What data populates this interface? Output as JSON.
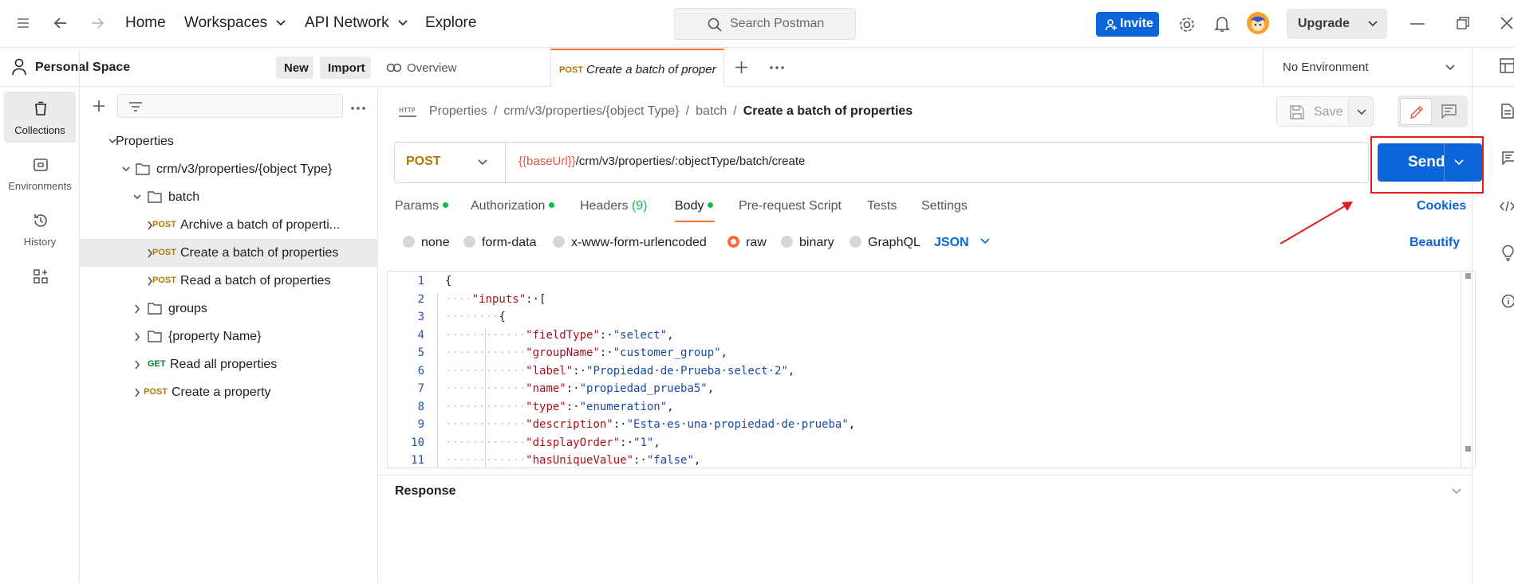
{
  "topbar": {
    "nav": [
      "Home",
      "Workspaces",
      "API Network",
      "Explore"
    ],
    "search_placeholder": "Search Postman",
    "invite_label": "Invite",
    "upgrade_label": "Upgrade",
    "accent": "#0b65d8"
  },
  "rail": {
    "items": [
      {
        "label": "Collections",
        "icon": "collections-icon"
      },
      {
        "label": "Environments",
        "icon": "environments-icon"
      },
      {
        "label": "History",
        "icon": "history-icon"
      },
      {
        "label": "",
        "icon": "apps-icon"
      }
    ]
  },
  "workspace": {
    "title": "Personal Space",
    "new_label": "New",
    "import_label": "Import"
  },
  "tree": [
    {
      "label": "Properties",
      "method": ""
    },
    {
      "label": "crm/v3/properties/{object Type}",
      "method": ""
    },
    {
      "label": "batch",
      "method": ""
    },
    {
      "label": "Archive a batch of properti...",
      "method": "POST"
    },
    {
      "label": "Create a batch of properties",
      "method": "POST"
    },
    {
      "label": "Read a batch of properties",
      "method": "POST"
    },
    {
      "label": "groups",
      "method": ""
    },
    {
      "label": "{property Name}",
      "method": ""
    },
    {
      "label": "Read all properties",
      "method": "GET"
    },
    {
      "label": "Create a property",
      "method": "POST"
    }
  ],
  "tabs": {
    "overview": "Overview",
    "active_method": "POST",
    "active_label": "Create a batch of proper",
    "environment": "No Environment"
  },
  "breadcrumb": {
    "parts": [
      "Properties",
      "crm/v3/properties/{object Type}",
      "batch"
    ],
    "current": "Create a batch of properties",
    "http_badge": "HTTP"
  },
  "toolbar": {
    "save_label": "Save"
  },
  "request": {
    "method": "POST",
    "url_var": "{{baseUrl}}",
    "url_path": "/crm/v3/properties/:objectType/batch/create",
    "send_label": "Send"
  },
  "request_tabs": {
    "params": "Params",
    "authorization": "Authorization",
    "headers": "Headers",
    "headers_count": "(9)",
    "body": "Body",
    "prerequest": "Pre-request Script",
    "tests": "Tests",
    "settings": "Settings",
    "cookies": "Cookies"
  },
  "body_options": {
    "modes": [
      "none",
      "form-data",
      "x-www-form-urlencoded",
      "raw",
      "binary",
      "GraphQL"
    ],
    "selected_mode": "raw",
    "format": "JSON",
    "beautify": "Beautify"
  },
  "code": {
    "line_numbers": [
      "1",
      "2",
      "3",
      "4",
      "5",
      "6",
      "7",
      "8",
      "9",
      "10",
      "11"
    ],
    "lines": [
      {
        "ws": "",
        "key": "",
        "val": "",
        "raw": "{"
      },
      {
        "ws": "····",
        "key": "\"inputs\"",
        "val": "",
        "raw": ":·["
      },
      {
        "ws": "········",
        "key": "",
        "val": "",
        "raw": "{"
      },
      {
        "ws": "············",
        "key": "\"fieldType\"",
        "val": "\"select\"",
        "raw": ","
      },
      {
        "ws": "············",
        "key": "\"groupName\"",
        "val": "\"customer_group\"",
        "raw": ","
      },
      {
        "ws": "············",
        "key": "\"label\"",
        "val": "\"Propiedad·de·Prueba·select·2\"",
        "raw": ","
      },
      {
        "ws": "············",
        "key": "\"name\"",
        "val": "\"propiedad_prueba5\"",
        "raw": ","
      },
      {
        "ws": "············",
        "key": "\"type\"",
        "val": "\"enumeration\"",
        "raw": ","
      },
      {
        "ws": "············",
        "key": "\"description\"",
        "val": "\"Esta·es·una·propiedad·de·prueba\"",
        "raw": ","
      },
      {
        "ws": "············",
        "key": "\"displayOrder\"",
        "val": "\"1\"",
        "raw": ","
      },
      {
        "ws": "············",
        "key": "\"hasUniqueValue\"",
        "val": "\"false\"",
        "raw": ","
      }
    ]
  },
  "response": {
    "title": "Response"
  },
  "colors": {
    "post": "#ad7a03",
    "get": "#007f31",
    "accent_orange": "#ff6c37",
    "highlight": "#e11b1b"
  }
}
